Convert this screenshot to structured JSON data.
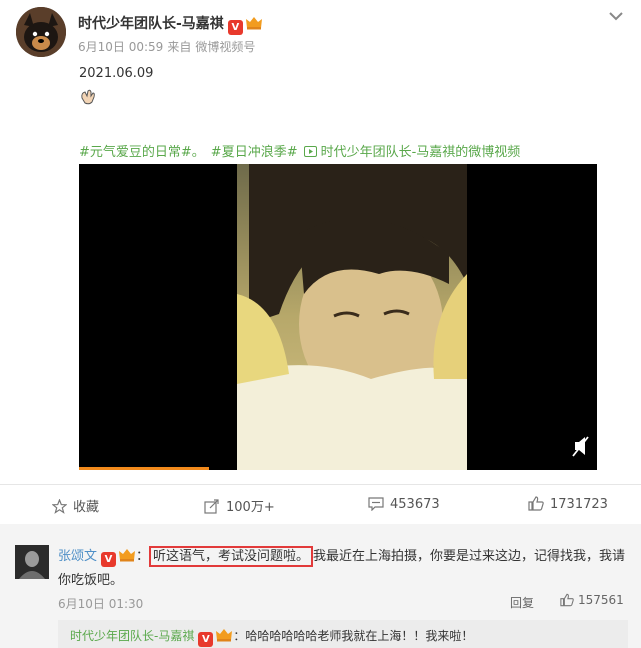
{
  "post": {
    "author": "时代少年团队长-马嘉祺",
    "verified_badge": "V",
    "time": "6月10日 00:59",
    "source_prefix": "来自",
    "source": "微博视频号",
    "date_text": "2021.06.09",
    "tags": [
      "#元气爱豆的日常#。",
      "#夏日冲浪季#"
    ],
    "video_link": "时代少年团队长-马嘉祺的微博视频",
    "video_progress": 0.25
  },
  "actions": {
    "favorite_label": "收藏",
    "share_count": "100万+",
    "comment_count": "453673",
    "like_count": "1731723"
  },
  "comment": {
    "author": "张颂文",
    "verified_badge": "V",
    "separator": "：",
    "highlight": "听这语气，考试没问题啦。",
    "rest": "我最近在上海拍摄，你要是过来这边，记得找我，我请",
    "line2": "你吃饭吧。",
    "time": "6月10日 01:30",
    "reply_label": "回复",
    "like_count": "157561"
  },
  "reply": {
    "author": "时代少年团队长-马嘉祺",
    "verified_badge": "V",
    "separator": "：",
    "text": "哈哈哈哈哈哈老师我就在上海！！我来啦！"
  },
  "colors": {
    "accent_green": "#5aa84b",
    "verified_red": "#e8392c",
    "highlight_red": "#e23a3a",
    "link_blue": "#4e8fc7"
  }
}
